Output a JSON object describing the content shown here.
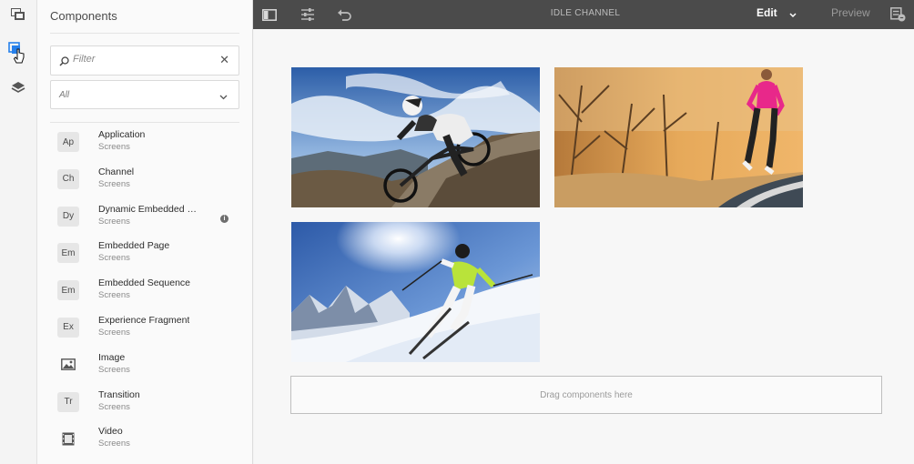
{
  "panel": {
    "title": "Components",
    "filter_placeholder": "Filter",
    "group_select_value": "All"
  },
  "components": [
    {
      "abbr": "Ap",
      "name": "Application",
      "group": "Screens",
      "icon": "badge"
    },
    {
      "abbr": "Ch",
      "name": "Channel",
      "group": "Screens",
      "icon": "badge"
    },
    {
      "abbr": "Dy",
      "name": "Dynamic Embedded S...",
      "group": "Screens",
      "icon": "badge",
      "info": true
    },
    {
      "abbr": "Em",
      "name": "Embedded Page",
      "group": "Screens",
      "icon": "badge"
    },
    {
      "abbr": "Em",
      "name": "Embedded Sequence",
      "group": "Screens",
      "icon": "badge"
    },
    {
      "abbr": "Ex",
      "name": "Experience Fragment",
      "group": "Screens",
      "icon": "badge"
    },
    {
      "abbr": "",
      "name": "Image",
      "group": "Screens",
      "icon": "image-icon"
    },
    {
      "abbr": "Tr",
      "name": "Transition",
      "group": "Screens",
      "icon": "badge"
    },
    {
      "abbr": "",
      "name": "Video",
      "group": "Screens",
      "icon": "film-icon"
    }
  ],
  "toolbar": {
    "title": "IDLE CHANNEL",
    "edit_label": "Edit",
    "preview_label": "Preview"
  },
  "canvas": {
    "dropzone_text": "Drag components here"
  },
  "colors": {
    "toolbar_bg": "#4b4b4b",
    "active_rail_icon": "#2680eb"
  }
}
